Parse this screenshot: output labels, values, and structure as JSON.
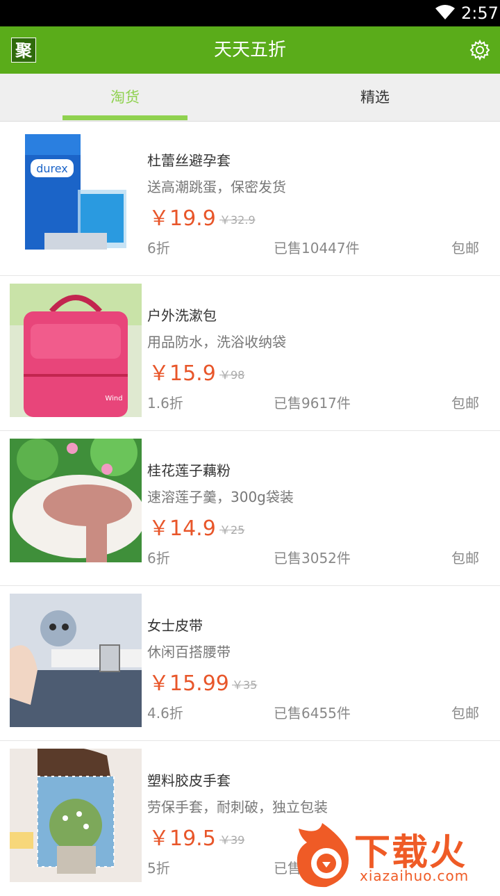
{
  "status_bar": {
    "time": "2:57"
  },
  "app_bar": {
    "logo": "聚",
    "title": "天天五折",
    "settings_icon": "gear-icon"
  },
  "tabs": [
    {
      "label": "淘货",
      "active": true
    },
    {
      "label": "精选",
      "active": false
    }
  ],
  "colors": {
    "brand": "#5aac1a",
    "tab_active": "#8fd14f",
    "price": "#e8562a"
  },
  "products": [
    {
      "name": "杜蕾丝避孕套",
      "desc": "送高潮跳蛋，保密发货",
      "price": "￥19.9",
      "original_price": "￥32.9",
      "discount": "6折",
      "sold": "已售10447件",
      "shipping": "包邮",
      "image_text": "durex"
    },
    {
      "name": "户外洗漱包",
      "desc": "用品防水，洗浴收纳袋",
      "price": "￥15.9",
      "original_price": "￥98",
      "discount": "1.6折",
      "sold": "已售9617件",
      "shipping": "包邮"
    },
    {
      "name": "桂花莲子藕粉",
      "desc": "速溶莲子羹，300g袋装",
      "price": "￥14.9",
      "original_price": "￥25",
      "discount": "6折",
      "sold": "已售3052件",
      "shipping": "包邮"
    },
    {
      "name": "女士皮带",
      "desc": "休闲百搭腰带",
      "price": "￥15.99",
      "original_price": "￥35",
      "discount": "4.6折",
      "sold": "已售6455件",
      "shipping": "包邮"
    },
    {
      "name": "塑料胶皮手套",
      "desc": "劳保手套，耐刺破，独立包装",
      "price": "￥19.5",
      "original_price": "￥39",
      "discount": "5折",
      "sold": "已售",
      "shipping": ""
    }
  ],
  "watermark": {
    "text": "下载火",
    "url": "xiazaihuo.com"
  }
}
